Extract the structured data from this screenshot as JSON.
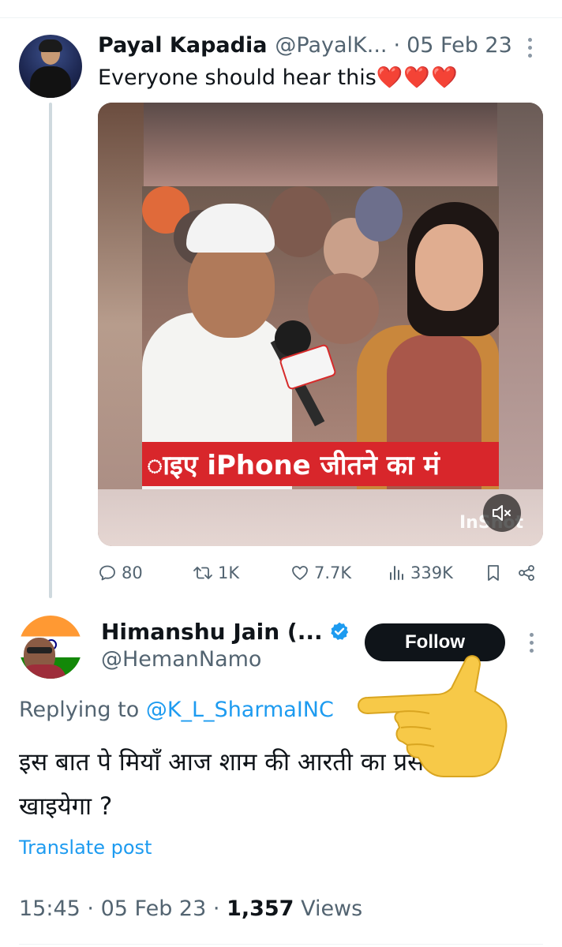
{
  "parent_tweet": {
    "author_name": "Payal Kapadia",
    "handle": "@PayalK...",
    "separator": "·",
    "date": "05 Feb 23",
    "text": "Everyone should hear this",
    "emoji": "❤️❤️❤️",
    "video": {
      "ticker_text": "ाइए iPhone जीतने का मं",
      "watermark": "InShot"
    },
    "stats": {
      "replies": "80",
      "reposts": "1K",
      "likes": "7.7K",
      "views": "339K"
    }
  },
  "reply_tweet": {
    "author_name": "Himanshu Jain (...",
    "handle": "@HemanNamo",
    "follow_label": "Follow",
    "replying_prefix": "Replying to",
    "replying_to": "@K_L_SharmaINC",
    "text": "इस बात पे मियाँ आज शाम की आरती का प्रसाद तो खाइयेगा ?",
    "translate_label": "Translate post",
    "time": "15:45",
    "date": "05 Feb 23",
    "separator": "·",
    "views_count": "1,357",
    "views_label": "Views"
  },
  "colors": {
    "link": "#1d9bf0",
    "secondary_text": "#536471",
    "follow_button_bg": "#0f1419",
    "ticker_red": "#d8262b"
  },
  "icons": [
    "more-icon",
    "reply-icon",
    "retweet-icon",
    "like-icon",
    "views-icon",
    "bookmark-icon",
    "share-icon",
    "verified-badge-icon",
    "mute-icon",
    "pointing-hand-emoji"
  ]
}
